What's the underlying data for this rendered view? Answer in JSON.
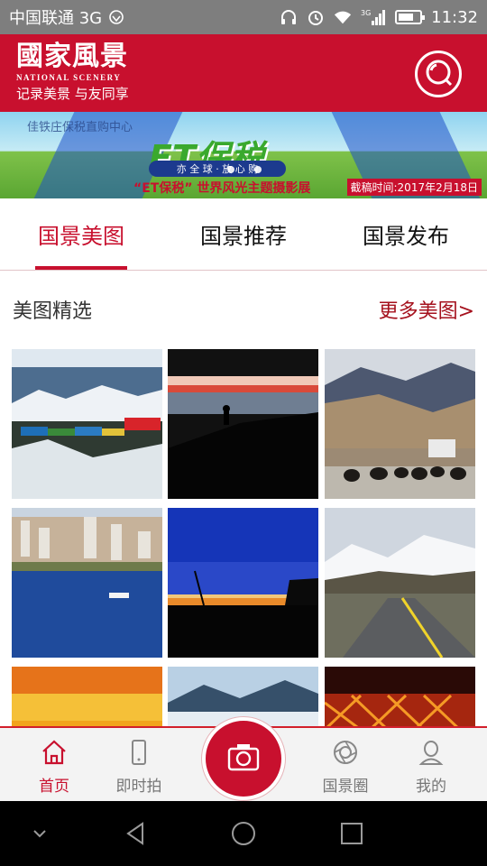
{
  "status_bar": {
    "carrier": "中国联通 3G",
    "network": "3G",
    "time": "11:32",
    "icons": [
      "signal-icon",
      "headphones-icon",
      "alarm-icon",
      "wifi-icon",
      "cell-signal-icon",
      "battery-icon"
    ]
  },
  "header": {
    "title": "國家風景",
    "subtitle": "NATIONAL SCENERY",
    "slogan": "记录美景 与友同享",
    "search_icon": "search-icon"
  },
  "banner": {
    "caption_left": "佳铁庄保税直购中心",
    "logo": "ET保税",
    "strip": "亦 全 球 · 放 心 购",
    "headline": "“ET保税” 世界风光主题摄影展",
    "deadline": "截稿时间:2017年2月18日"
  },
  "tabs": [
    {
      "label": "国景美图",
      "active": true
    },
    {
      "label": "国景推荐",
      "active": false
    },
    {
      "label": "国景发布",
      "active": false
    }
  ],
  "section": {
    "title": "美图精选",
    "more": "更多美图>"
  },
  "photos": [
    {
      "name": "photo-mountain-prayer-flags"
    },
    {
      "name": "photo-silhouette-hiker-sunset"
    },
    {
      "name": "photo-yak-herd-road"
    },
    {
      "name": "photo-coastal-city-seaplane"
    },
    {
      "name": "photo-night-sky-yurt"
    },
    {
      "name": "photo-snow-mountain-road"
    },
    {
      "name": "photo-orange-sunset"
    },
    {
      "name": "photo-misty-mountains"
    },
    {
      "name": "photo-birds-nest-stadium"
    }
  ],
  "bottom_nav": [
    {
      "label": "首页",
      "icon": "home-icon",
      "active": true
    },
    {
      "label": "即时拍",
      "icon": "phone-icon",
      "active": false
    },
    {
      "label": "",
      "icon": "camera-icon",
      "active": false
    },
    {
      "label": "国景圈",
      "icon": "aperture-icon",
      "active": false
    },
    {
      "label": "我的",
      "icon": "user-icon",
      "active": false
    }
  ],
  "colors": {
    "brand_red": "#c8102e",
    "status_bar": "#7e7e7e",
    "text_dark": "#111111",
    "nav_bg": "#f3f3f3"
  }
}
